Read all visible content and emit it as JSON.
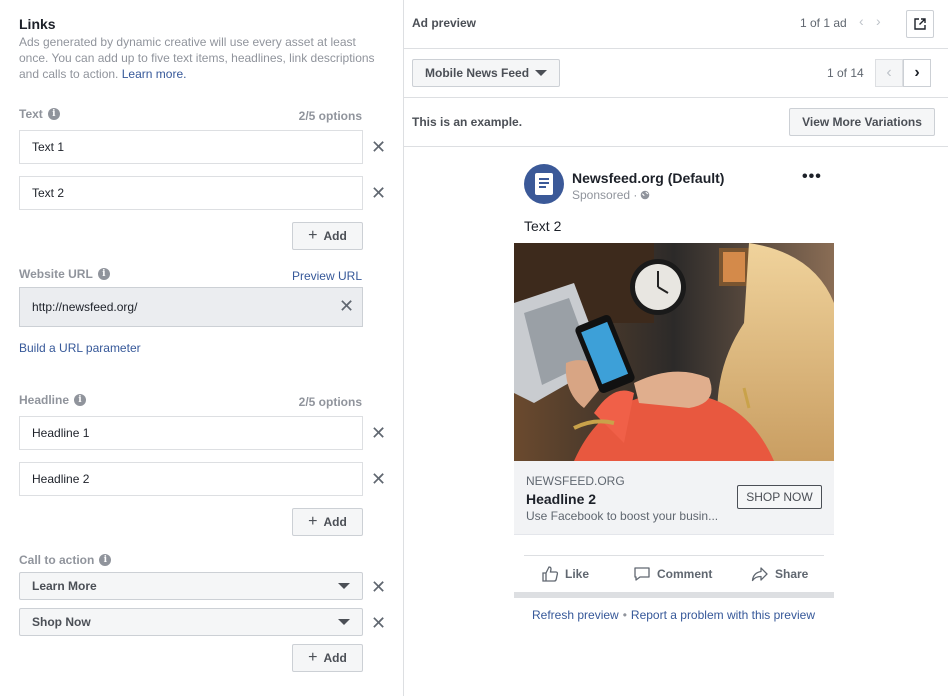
{
  "links_panel": {
    "title": "Links",
    "description": "Ads generated by dynamic creative will use every asset at least once. You can add up to five text items, headlines, link descriptions and calls to action.",
    "learn_more": "Learn more.",
    "text_section": {
      "label": "Text",
      "count": "2/5 options",
      "items": [
        "Text 1",
        "Text 2"
      ],
      "add_label": "Add"
    },
    "website_url": {
      "label": "Website URL",
      "preview_link": "Preview URL",
      "value": "http://newsfeed.org/",
      "build_param": "Build a URL parameter"
    },
    "headline_section": {
      "label": "Headline",
      "count": "2/5 options",
      "items": [
        "Headline 1",
        "Headline 2"
      ],
      "add_label": "Add"
    },
    "cta_section": {
      "label": "Call to action",
      "items": [
        "Learn More",
        "Shop Now"
      ],
      "add_label": "Add"
    }
  },
  "preview_panel": {
    "title": "Ad preview",
    "ad_counter": "1 of 1 ad",
    "placement": "Mobile News Feed",
    "page_counter": "1 of 14",
    "example_text": "This is an example.",
    "view_variations": "View More Variations",
    "post": {
      "page_name": "Newsfeed.org (Default)",
      "sponsored": "Sponsored ·",
      "body_text": "Text 2",
      "domain": "NEWSFEED.ORG",
      "headline": "Headline 2",
      "description": "Use Facebook to boost your busin...",
      "cta": "SHOP NOW",
      "actions": [
        "Like",
        "Comment",
        "Share"
      ]
    },
    "refresh_link": "Refresh preview",
    "separator": "•",
    "report_link": "Report a problem with this preview"
  },
  "icons": [
    "info-icon",
    "close-icon",
    "plus-icon",
    "caret-down-icon",
    "chevron-left-icon",
    "chevron-right-icon",
    "external-link-icon",
    "more-icon",
    "globe-icon",
    "like-icon",
    "comment-icon",
    "share-icon"
  ]
}
